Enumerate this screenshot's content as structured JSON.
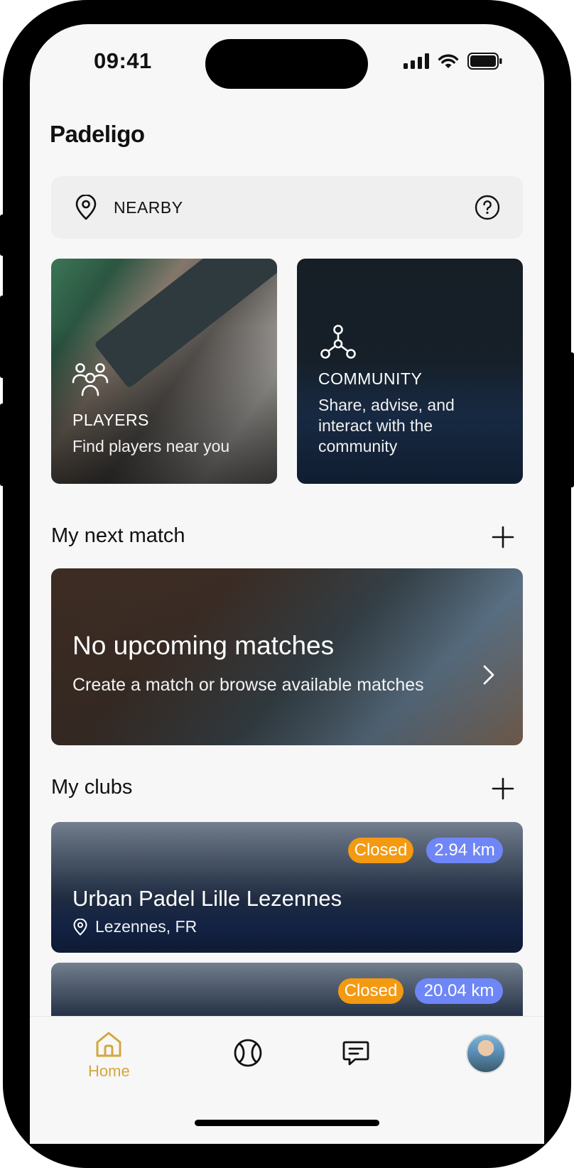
{
  "status_bar": {
    "time": "09:41"
  },
  "app": {
    "logo": "Padeligo"
  },
  "location_bar": {
    "label": "NEARBY",
    "pin_icon": "location-pin-icon",
    "help_icon": "help-circle-icon"
  },
  "feature_cards": [
    {
      "title": "PLAYERS",
      "subtitle": "Find players near you",
      "icon": "users-icon"
    },
    {
      "title": "COMMUNITY",
      "subtitle": "Share, advise, and interact with the community",
      "icon": "network-icon"
    }
  ],
  "next_match": {
    "section_title": "My next match",
    "title": "No upcoming matches",
    "subtitle": "Create a match or browse available matches"
  },
  "clubs": {
    "section_title": "My clubs",
    "items": [
      {
        "name": "Urban Padel Lille Lezennes",
        "location": "Lezennes, FR",
        "status": "Closed",
        "distance": "2.94 km"
      },
      {
        "name": "",
        "location": "",
        "status": "Closed",
        "distance": "20.04 km"
      }
    ]
  },
  "tab_bar": {
    "items": [
      {
        "label": "Home",
        "icon": "home-icon",
        "active": true
      },
      {
        "label": "",
        "icon": "tennis-ball-icon",
        "active": false
      },
      {
        "label": "",
        "icon": "chat-icon",
        "active": false
      },
      {
        "label": "",
        "icon": "profile-avatar",
        "active": false
      }
    ]
  },
  "colors": {
    "accent": "#d4a73d",
    "closed_badge": "#f39a12",
    "distance_badge": "#6f86f7"
  }
}
